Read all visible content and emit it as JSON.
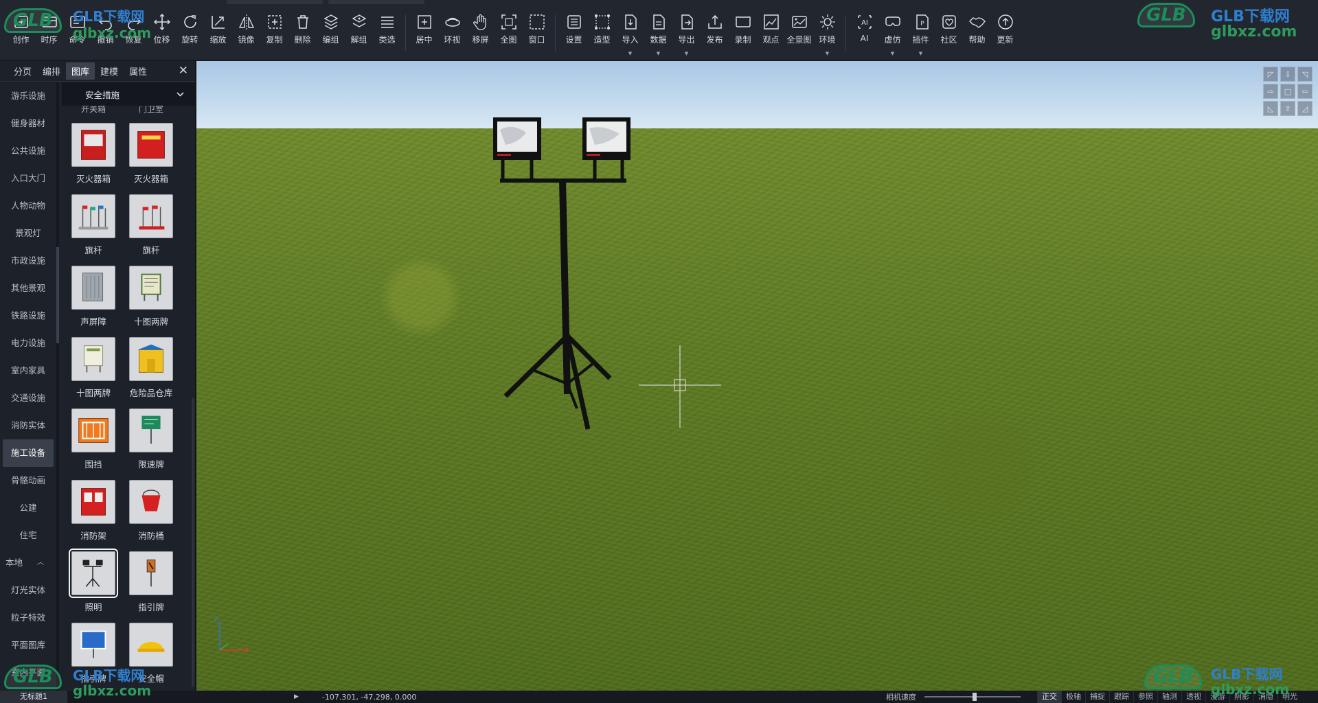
{
  "toolbar": {
    "groups": [
      [
        {
          "id": "create",
          "label": "创作",
          "icon": "create-icon"
        },
        {
          "id": "timeline",
          "label": "时序",
          "icon": "timeline-icon"
        },
        {
          "id": "command",
          "label": "命令",
          "icon": "command-icon"
        },
        {
          "id": "undo",
          "label": "撤销",
          "icon": "undo-icon"
        },
        {
          "id": "redo",
          "label": "恢复",
          "icon": "redo-icon"
        },
        {
          "id": "move",
          "label": "位移",
          "icon": "move-icon"
        },
        {
          "id": "rotate",
          "label": "旋转",
          "icon": "rotate-icon"
        },
        {
          "id": "scale",
          "label": "缩放",
          "icon": "scale-icon"
        },
        {
          "id": "mirror",
          "label": "镜像",
          "icon": "mirror-icon"
        },
        {
          "id": "copy",
          "label": "复制",
          "icon": "copy-icon"
        },
        {
          "id": "delete",
          "label": "删除",
          "icon": "delete-icon"
        },
        {
          "id": "group",
          "label": "编组",
          "icon": "group-icon"
        },
        {
          "id": "ungroup",
          "label": "解组",
          "icon": "ungroup-icon"
        },
        {
          "id": "select-type",
          "label": "类选",
          "icon": "list-icon"
        }
      ],
      [
        {
          "id": "center",
          "label": "居中",
          "icon": "center-icon"
        },
        {
          "id": "orbit",
          "label": "环视",
          "icon": "orbit-icon"
        },
        {
          "id": "pan",
          "label": "移屏",
          "icon": "hand-icon"
        },
        {
          "id": "fit-all",
          "label": "全图",
          "icon": "fit-all-icon"
        },
        {
          "id": "window",
          "label": "窗口",
          "icon": "window-icon"
        }
      ],
      [
        {
          "id": "settings",
          "label": "设置",
          "icon": "settings-icon"
        },
        {
          "id": "modeling",
          "label": "造型",
          "icon": "modeling-icon"
        },
        {
          "id": "import",
          "label": "导入",
          "icon": "import-icon",
          "dropdown": true
        },
        {
          "id": "data",
          "label": "数据",
          "icon": "data-icon",
          "dropdown": true
        },
        {
          "id": "export",
          "label": "导出",
          "icon": "export-icon",
          "dropdown": true
        },
        {
          "id": "publish",
          "label": "发布",
          "icon": "publish-icon"
        },
        {
          "id": "record",
          "label": "录制",
          "icon": "record-icon"
        },
        {
          "id": "viewpoint",
          "label": "观点",
          "icon": "viewpoint-icon"
        },
        {
          "id": "panorama",
          "label": "全景图",
          "icon": "panorama-icon"
        },
        {
          "id": "environment",
          "label": "环境",
          "icon": "sun-icon",
          "dropdown": true
        }
      ],
      [
        {
          "id": "ai",
          "label": "AI",
          "icon": "ai-icon"
        },
        {
          "id": "vr",
          "label": "虚仿",
          "icon": "vr-icon",
          "dropdown": true
        },
        {
          "id": "plugin",
          "label": "插件",
          "icon": "plugin-icon",
          "dropdown": true
        },
        {
          "id": "community",
          "label": "社区",
          "icon": "community-icon"
        },
        {
          "id": "help",
          "label": "帮助",
          "icon": "handshake-icon"
        },
        {
          "id": "update",
          "label": "更新",
          "icon": "update-icon"
        }
      ]
    ]
  },
  "panel": {
    "tabs": [
      {
        "label": "分页",
        "active": false
      },
      {
        "label": "编排",
        "active": false
      },
      {
        "label": "图库",
        "active": true
      },
      {
        "label": "建模",
        "active": false
      },
      {
        "label": "属性",
        "active": false
      }
    ],
    "categories": [
      {
        "label": "游乐设施"
      },
      {
        "label": "健身器材"
      },
      {
        "label": "公共设施"
      },
      {
        "label": "入口大门"
      },
      {
        "label": "人物动物"
      },
      {
        "label": "景观灯"
      },
      {
        "label": "市政设施"
      },
      {
        "label": "其他景观"
      },
      {
        "label": "铁路设施"
      },
      {
        "label": "电力设施"
      },
      {
        "label": "室内家具"
      },
      {
        "label": "交通设施"
      },
      {
        "label": "消防实体"
      },
      {
        "label": "施工设备",
        "active": true
      },
      {
        "label": "骨骼动画"
      },
      {
        "label": "公建"
      },
      {
        "label": "住宅"
      },
      {
        "label": "本地",
        "local": true
      },
      {
        "label": "灯光实体"
      },
      {
        "label": "粒子特效"
      },
      {
        "label": "平面图库"
      },
      {
        "label": "室内平面"
      }
    ],
    "library_select": "安全措施",
    "cut_labels": [
      "开关箱",
      "门卫室"
    ],
    "items": [
      {
        "label": "灭火器箱",
        "thumb": "fire-extinguisher-box"
      },
      {
        "label": "灭火器箱",
        "thumb": "fire-extinguisher-box-2"
      },
      {
        "label": "旗杆",
        "thumb": "flagpole"
      },
      {
        "label": "旗杆",
        "thumb": "flagpole-2"
      },
      {
        "label": "声屏障",
        "thumb": "sound-barrier"
      },
      {
        "label": "十图两牌",
        "thumb": "signboard"
      },
      {
        "label": "十图两牌",
        "thumb": "signboard-2"
      },
      {
        "label": "危险品仓库",
        "thumb": "hazmat-storage"
      },
      {
        "label": "围挡",
        "thumb": "fence"
      },
      {
        "label": "限速牌",
        "thumb": "speed-sign"
      },
      {
        "label": "消防架",
        "thumb": "fire-rack"
      },
      {
        "label": "消防桶",
        "thumb": "fire-bucket"
      },
      {
        "label": "照明",
        "thumb": "floodlight",
        "selected": true
      },
      {
        "label": "指引牌",
        "thumb": "guide-sign"
      },
      {
        "label": "指引牌",
        "thumb": "guide-sign-2"
      },
      {
        "label": "安全帽",
        "thumb": "hard-hat"
      }
    ]
  },
  "viewport": {
    "axis_z": "Z",
    "axis_x": "X",
    "nav_cube": [
      "◸",
      "⇩",
      "◹",
      "⇨",
      "□",
      "⇦",
      "◺",
      "⇧",
      "◿"
    ]
  },
  "status": {
    "doc_tab": "无标题1",
    "coords": "-107.301, -47.298, 0.000",
    "speed_label": "相机速度",
    "toggles": [
      {
        "label": "正交",
        "on": true
      },
      {
        "label": "极轴",
        "on": false
      },
      {
        "label": "捕捉",
        "on": false
      },
      {
        "label": "跟踪",
        "on": false
      },
      {
        "label": "参照",
        "on": false
      },
      {
        "label": "轴测",
        "on": false
      },
      {
        "label": "透视",
        "on": false
      },
      {
        "label": "漫游",
        "on": false
      },
      {
        "label": "阴影",
        "on": false
      },
      {
        "label": "消隐",
        "on": false
      },
      {
        "label": "明光",
        "on": false
      }
    ]
  },
  "watermark": {
    "badge": "GLB",
    "cn": "GLB下载网",
    "url": "glbxz.com"
  },
  "colors": {
    "toolbar_bg": "#22262e",
    "panel_bg": "#1d2129",
    "active_tab": "#3c424d",
    "watermark_green": "#1a8f5a",
    "watermark_blue": "#2f7fd0"
  }
}
